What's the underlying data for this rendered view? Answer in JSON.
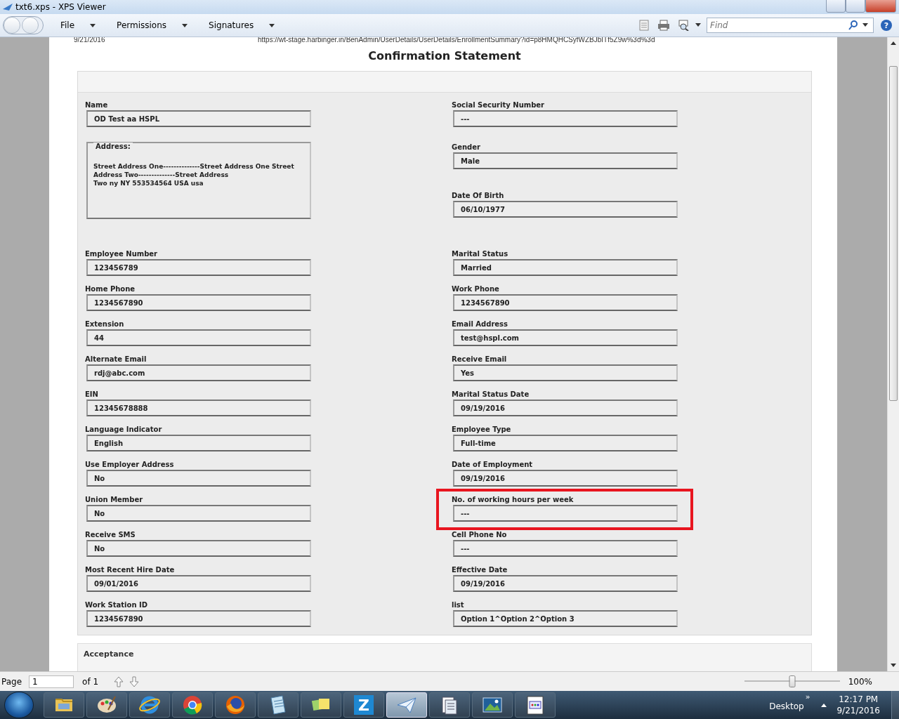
{
  "window": {
    "title": "txt6.xps - XPS Viewer"
  },
  "menu": [
    {
      "label": "File"
    },
    {
      "label": "Permissions"
    },
    {
      "label": "Signatures"
    }
  ],
  "find": {
    "placeholder": "Find"
  },
  "help": "?",
  "document": {
    "date": "9/21/2016",
    "url": "https://wt-stage.harbinger.in/BenAdmin/UserDetails/UserDetails/EnrollmentSummary?id=p8HMQHCSyfWZBJbITf5Z9w%3d%3d",
    "title": "Confirmation Statement",
    "top_left": {
      "name": {
        "label": "Name",
        "value": "OD Test aa HSPL"
      },
      "address": {
        "label": "Address:",
        "lines": [
          "Street Address One--------------Street Address One Street",
          "Address Two--------------Street Address",
          "Two ny NY 553534564 USA usa"
        ]
      }
    },
    "top_right": [
      {
        "label": "Social Security Number",
        "value": "---"
      },
      {
        "label": "Gender",
        "value": "Male"
      },
      {
        "label": "Date Of Birth",
        "value": "06/10/1977"
      }
    ],
    "field_rows": [
      {
        "left": {
          "label": "Employee Number",
          "value": "123456789",
          "highlighted": false
        },
        "right": {
          "label": "Marital Status",
          "value": "Married",
          "highlighted": false
        }
      },
      {
        "left": {
          "label": "Home Phone",
          "value": "1234567890",
          "highlighted": false
        },
        "right": {
          "label": "Work Phone",
          "value": "1234567890",
          "highlighted": false
        }
      },
      {
        "left": {
          "label": "Extension",
          "value": "44",
          "highlighted": false
        },
        "right": {
          "label": "Email Address",
          "value": "test@hspl.com",
          "highlighted": false
        }
      },
      {
        "left": {
          "label": "Alternate Email",
          "value": "rdj@abc.com",
          "highlighted": false
        },
        "right": {
          "label": "Receive Email",
          "value": "Yes",
          "highlighted": false
        }
      },
      {
        "left": {
          "label": "EIN",
          "value": "12345678888",
          "highlighted": false
        },
        "right": {
          "label": "Marital Status Date",
          "value": "09/19/2016",
          "highlighted": false
        }
      },
      {
        "left": {
          "label": "Language Indicator",
          "value": "English",
          "highlighted": false
        },
        "right": {
          "label": "Employee Type",
          "value": "Full-time",
          "highlighted": false
        }
      },
      {
        "left": {
          "label": "Use Employer Address",
          "value": "No",
          "highlighted": false
        },
        "right": {
          "label": "Date of Employment",
          "value": "09/19/2016",
          "highlighted": false
        }
      },
      {
        "left": {
          "label": "Union Member",
          "value": "No",
          "highlighted": false
        },
        "right": {
          "label": "No. of working hours per week",
          "value": "---",
          "highlighted": true
        }
      },
      {
        "left": {
          "label": "Receive SMS",
          "value": "No",
          "highlighted": false
        },
        "right": {
          "label": "Cell Phone No",
          "value": "---",
          "highlighted": false
        }
      },
      {
        "left": {
          "label": "Most Recent Hire Date",
          "value": "09/01/2016",
          "highlighted": false
        },
        "right": {
          "label": "Effective Date",
          "value": "09/19/2016",
          "highlighted": false
        }
      },
      {
        "left": {
          "label": "Work Station ID",
          "value": "1234567890",
          "highlighted": false
        },
        "right": {
          "label": "list",
          "value": "Option 1^Option 2^Option 3",
          "highlighted": false
        }
      }
    ],
    "acceptance": {
      "title": "Acceptance"
    }
  },
  "status_bar": {
    "page_label": "Page",
    "page": "1",
    "page_count": "of 1",
    "zoom": {
      "level": 0.5
    },
    "zoom_text": "100%"
  },
  "taskbar": {
    "items": [
      {
        "kind": "folder",
        "selected": false
      },
      {
        "kind": "palette",
        "selected": false
      },
      {
        "kind": "ie",
        "selected": false
      },
      {
        "kind": "chrome",
        "selected": false
      },
      {
        "kind": "firefox",
        "selected": false
      },
      {
        "kind": "notepad",
        "selected": false
      },
      {
        "kind": "notes",
        "selected": false
      },
      {
        "kind": "letter",
        "text": "Z",
        "selected": false
      },
      {
        "kind": "plane",
        "selected": true
      },
      {
        "kind": "scanner",
        "selected": false
      },
      {
        "kind": "picture",
        "selected": false
      },
      {
        "kind": "docwindow",
        "selected": false
      }
    ],
    "desktop": "Desktop",
    "chevron": "»",
    "time": "12:17 PM",
    "date": "9/21/2016"
  }
}
